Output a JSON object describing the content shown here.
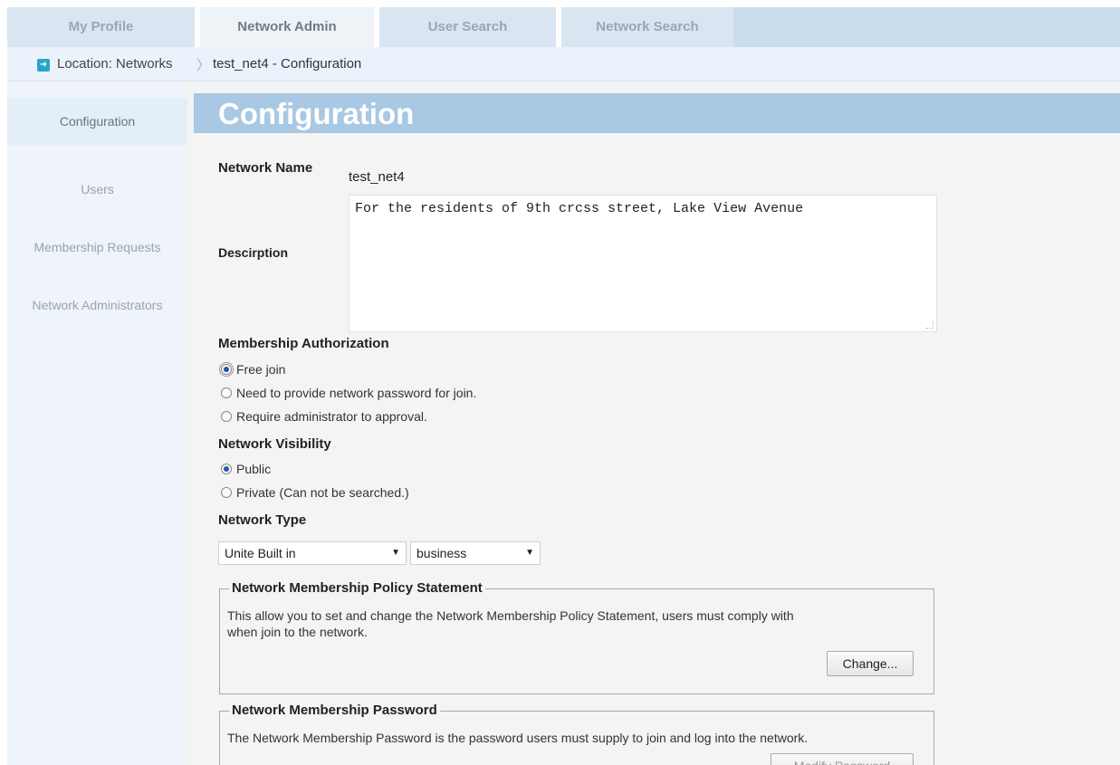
{
  "tabs": [
    {
      "label": "My Profile"
    },
    {
      "label": "Network Admin"
    },
    {
      "label": "User Search"
    },
    {
      "label": "Network Search"
    }
  ],
  "breadcrumb": {
    "location": "Location: Networks",
    "separator": "〉",
    "current": "test_net4  - Configuration"
  },
  "sidebar": {
    "items": [
      {
        "label": "Configuration"
      },
      {
        "label": "Users"
      },
      {
        "label": "Membership Requests"
      },
      {
        "label": "Network Administrators"
      }
    ]
  },
  "page": {
    "title": "Configuration",
    "network_name_label": "Network Name",
    "network_name_value": "test_net4",
    "description_label": "Descirption",
    "description_value": "For the residents of 9th crcss street, Lake View Avenue",
    "membership_auth_label": "Membership Authorization",
    "membership_auth_options": [
      "Free join",
      "Need to provide network password for join.",
      "Require administrator to approval."
    ],
    "visibility_label": "Network Visibility",
    "visibility_options": [
      "Public",
      "Private (Can not be searched.)"
    ],
    "network_type_label": "Network Type",
    "network_type_select_1": "Unite Built in",
    "network_type_select_2": "business",
    "policy": {
      "legend": "Network Membership Policy Statement",
      "text_line1": "This allow you to set and change the Network Membership Policy Statement, users must comply with",
      "text_line2": "when join to the network.",
      "button": "Change..."
    },
    "password": {
      "legend": "Network Membership Password",
      "text": "The Network Membership Password is the password users must supply to join and log into the network.",
      "button": "Modify Password"
    }
  },
  "colors": {
    "tab_bar": "#c9ddef",
    "header_band": "#a8c8e3",
    "radio_selected": "#1d5aa8"
  }
}
